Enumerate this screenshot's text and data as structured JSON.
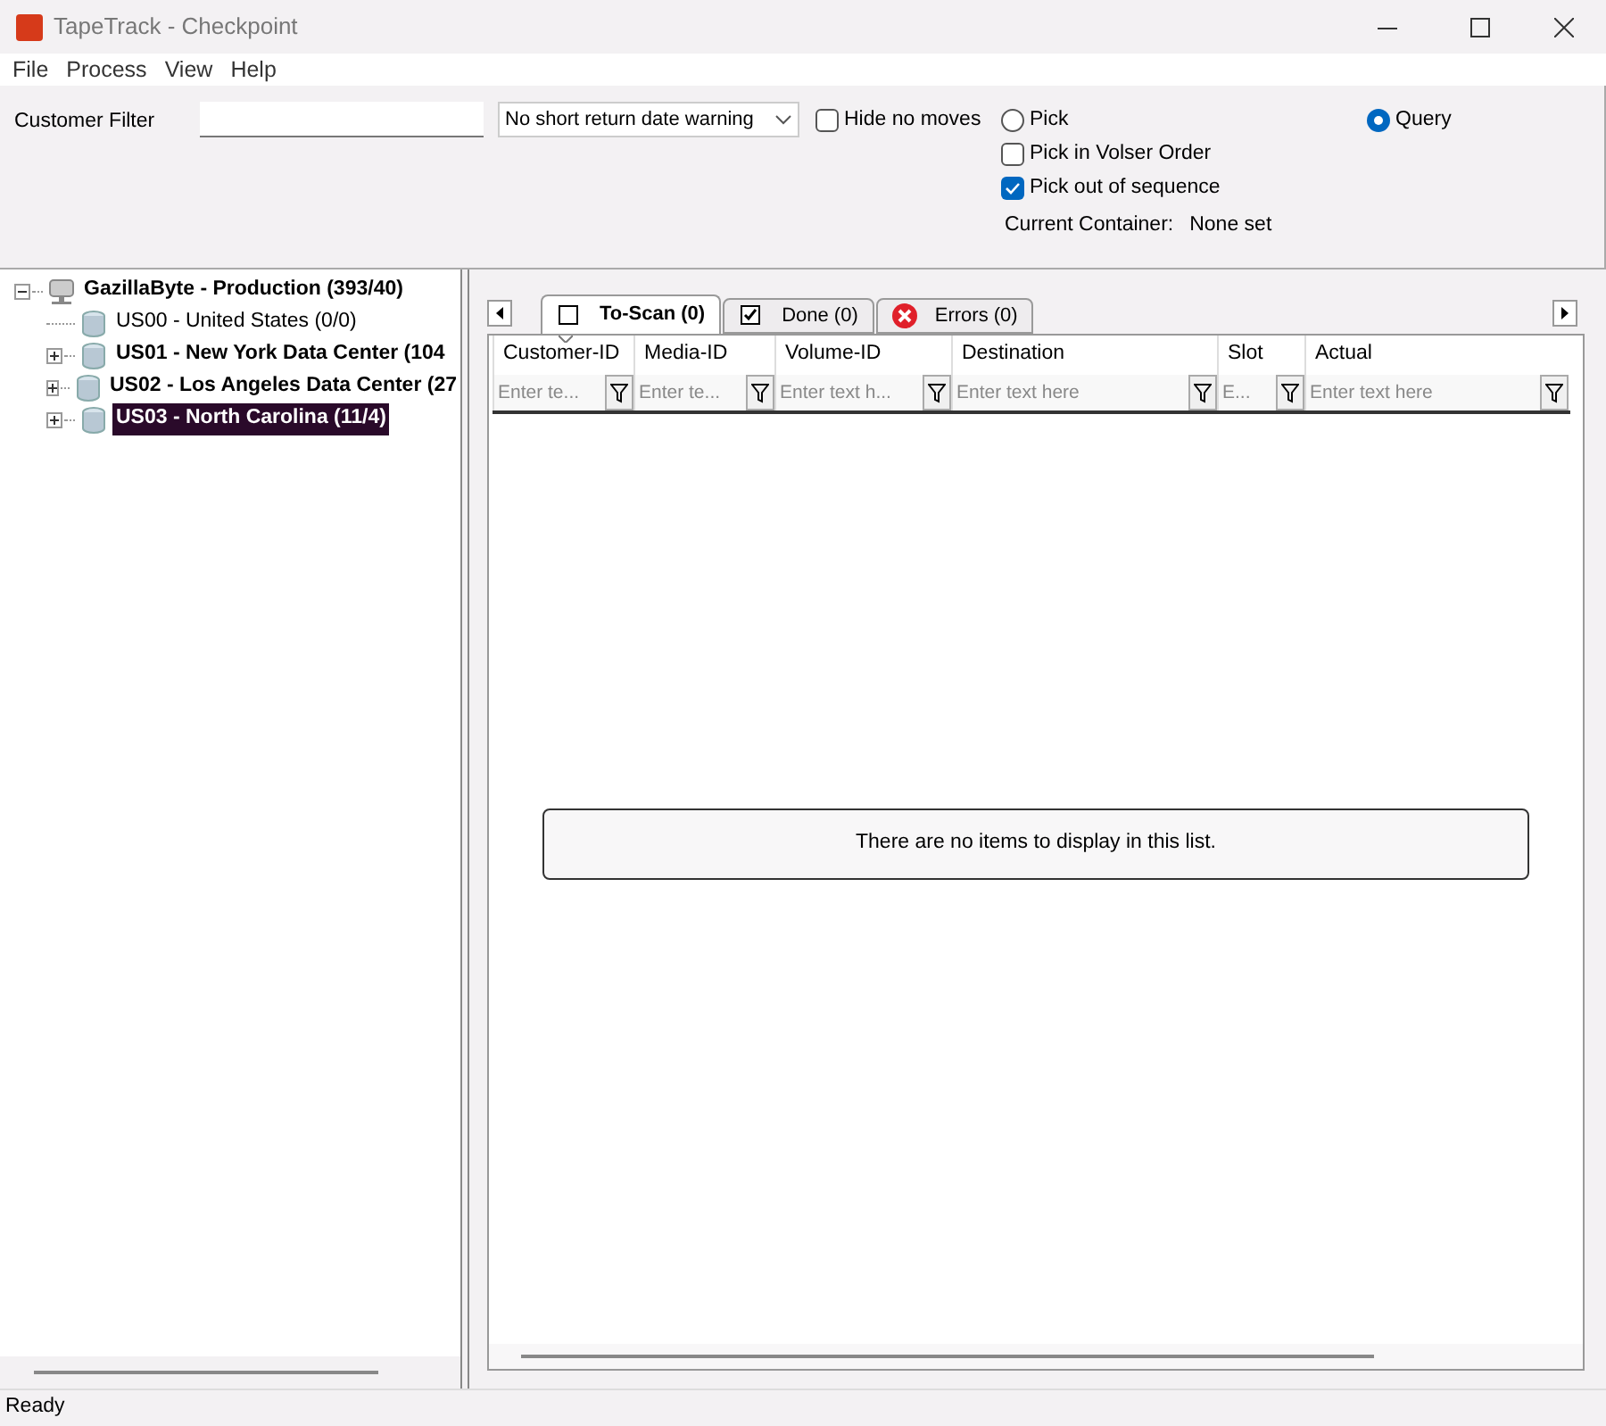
{
  "window": {
    "title": "TapeTrack - Checkpoint"
  },
  "menu": [
    "File",
    "Process",
    "View",
    "Help"
  ],
  "filters": {
    "customer_filter_label": "Customer Filter",
    "return_warning": "No short return date warning",
    "hide_no_moves": {
      "label": "Hide no moves",
      "checked": false
    }
  },
  "mode": [
    {
      "label": "Pick",
      "selected": false
    },
    {
      "label": "Query",
      "selected": true
    }
  ],
  "pick_options": [
    {
      "label": "Pick in Volser Order",
      "checked": false
    },
    {
      "label": "Pick out of sequence",
      "checked": true
    }
  ],
  "current_container": {
    "label": "Current Container:",
    "value": "None set"
  },
  "tree": [
    {
      "label": "GazillaByte - Production (393/40)",
      "bold": true,
      "selected": false,
      "expanded": true,
      "children": [
        {
          "label": "US00 - United States (0/0)",
          "bold": false,
          "selected": false
        },
        {
          "label": "US01 - New York Data Center (104",
          "bold": true,
          "selected": false,
          "expanded": false
        },
        {
          "label": "US02 - Los Angeles Data Center (27",
          "bold": true,
          "selected": false,
          "expanded": false
        },
        {
          "label": "US03 - North Carolina (11/4)",
          "bold": true,
          "selected": true,
          "expanded": false
        }
      ]
    }
  ],
  "tabs": [
    {
      "label": "To-Scan (0)",
      "kind": "unchecked",
      "selected": true
    },
    {
      "label": "Done (0)",
      "kind": "checked",
      "selected": false
    },
    {
      "label": "Errors (0)",
      "kind": "error",
      "selected": false
    }
  ],
  "table": {
    "columns": [
      {
        "title": "Customer-ID",
        "placeholder": "Enter te...",
        "sorted": true
      },
      {
        "title": "Media-ID",
        "placeholder": "Enter te...",
        "sorted": false
      },
      {
        "title": "Volume-ID",
        "placeholder": "Enter text h...",
        "sorted": false
      },
      {
        "title": "Destination",
        "placeholder": "Enter text here",
        "sorted": false
      },
      {
        "title": "Slot",
        "placeholder": "E...",
        "sorted": false
      },
      {
        "title": "Actual",
        "placeholder": "Enter text here",
        "sorted": false
      }
    ],
    "empty_message": "There are no items to display in this list."
  },
  "status_bar": "Ready"
}
